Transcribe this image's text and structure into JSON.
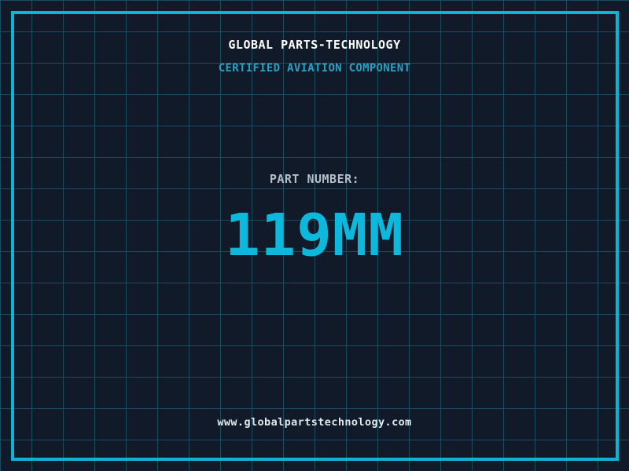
{
  "header": {
    "title": "GLOBAL PARTS-TECHNOLOGY",
    "subtitle": "CERTIFIED AVIATION COMPONENT"
  },
  "part": {
    "label": "PART NUMBER:",
    "value": "119MM"
  },
  "footer": {
    "website": "www.globalpartstechnology.com"
  },
  "colors": {
    "background": "#101a29",
    "grid_line": "#1c4a5f",
    "frame_border": "#0cb4d6",
    "title_text": "#ffffff",
    "subtitle_text": "#2aa0c2",
    "part_label_text": "#b3bec7",
    "part_value_text": "#0cb9dd",
    "footer_text": "#e2e9ee"
  }
}
